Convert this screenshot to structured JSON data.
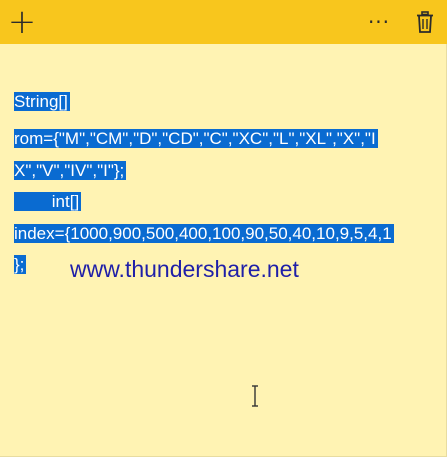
{
  "toolbar": {
    "add_glyph": "+",
    "more_glyph": "···"
  },
  "note": {
    "lines": [
      "String[]",
      "rom={\"M\",\"CM\",\"D\",\"CD\",\"C\",\"XC\",\"L\",\"XL\",\"X\",\"I",
      "X\",\"V\",\"IV\",\"I\"};",
      "        int[]",
      "index={1000,900,500,400,100,90,50,40,10,9,5,4,1",
      "};"
    ],
    "selection_color": "#0a6bd1"
  },
  "watermark": {
    "text": "www.thundershare.net"
  },
  "colors": {
    "titlebar": "#f8c61d",
    "note_background": "#fff3b3"
  }
}
